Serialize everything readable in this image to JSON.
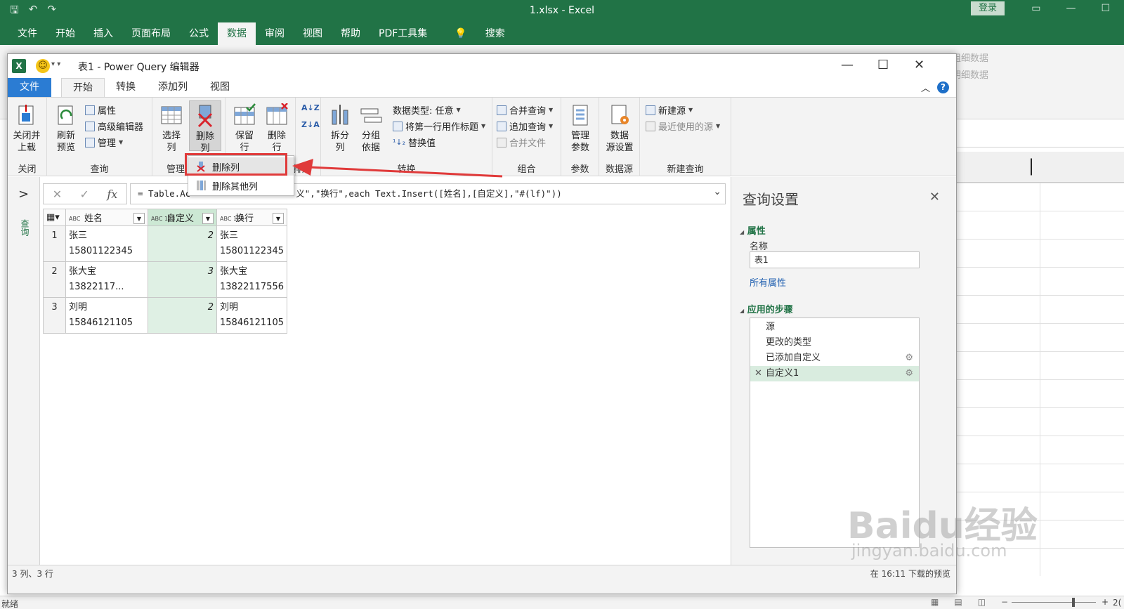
{
  "excel": {
    "title": "1.xlsx  -  Excel",
    "login": "登录",
    "menu": [
      "文件",
      "开始",
      "插入",
      "页面布局",
      "公式",
      "数据",
      "审阅",
      "视图",
      "帮助",
      "PDF工具集",
      "搜索"
    ],
    "active_menu": "数据",
    "ribbon_hint_1": "组细数据",
    "ribbon_hint_2": "明细数据",
    "status_ready": "就绪",
    "zoom": "2("
  },
  "pq": {
    "title": "表1 - Power Query 编辑器",
    "tabs": [
      "文件",
      "开始",
      "转换",
      "添加列",
      "视图"
    ],
    "ribbon": {
      "close": {
        "btn": "关闭并\n上载",
        "group": "关闭"
      },
      "query": {
        "refresh": "刷新\n预览",
        "props": "属性",
        "advanced": "高级编辑器",
        "manage": "管理",
        "group": "查询"
      },
      "manage_cols": {
        "select": "选择\n列",
        "remove": "删除\n列",
        "group": "管理"
      },
      "reduce_rows": {
        "keep": "保留\n行",
        "remove": "删除\n行",
        "group": "排序"
      },
      "transform": {
        "split": "拆分\n列",
        "groupby": "分组\n依据",
        "dtype": "数据类型: 任意",
        "firstrow": "将第一行用作标题",
        "replace": "替换值",
        "group": "转换"
      },
      "combine": {
        "merge": "合并查询",
        "append": "追加查询",
        "files": "合并文件",
        "group": "组合"
      },
      "params": {
        "btn": "管理\n参数",
        "group": "参数"
      },
      "datasource": {
        "btn": "数据\n源设置",
        "group": "数据源"
      },
      "newquery": {
        "new": "新建源",
        "recent": "最近使用的源",
        "group": "新建查询"
      }
    },
    "dropdown": [
      "删除列",
      "删除其他列"
    ],
    "left_label": "查询",
    "formula": "= Table.AddColumn(更改的类型, \"自定义\",\"换行\",each Text.Insert([姓名],[自定义],\"#(lf)\"))",
    "formula_visible": "= Table.Ac",
    "formula_tail": "义\",\"换行\",each Text.Insert([姓名],[自定义],\"#(lf)\"))",
    "columns": [
      {
        "type": "ABC",
        "name": "姓名"
      },
      {
        "type": "ABC 123",
        "name": "自定义"
      },
      {
        "type": "ABC 123",
        "name": "换行"
      }
    ],
    "rows": [
      {
        "n": "1",
        "name": "张三15801122345",
        "custom": "2",
        "break1": "张三",
        "break2": "15801122345"
      },
      {
        "n": "2",
        "name": "张大宝13822117...",
        "custom": "3",
        "break1": "张大宝",
        "break2": "13822117556"
      },
      {
        "n": "3",
        "name": "刘明15846121105",
        "custom": "2",
        "break1": "刘明",
        "break2": "15846121105"
      }
    ],
    "settings": {
      "title": "查询设置",
      "props_section": "属性",
      "name_label": "名称",
      "name_value": "表1",
      "all_props": "所有属性",
      "steps_section": "应用的步骤",
      "steps": [
        "源",
        "更改的类型",
        "已添加自定义",
        "自定义1"
      ]
    },
    "status_left": "3 列、3 行",
    "status_right": "在 16:11 下载的预览"
  },
  "watermark": {
    "brand": "Baidu经验",
    "url": "jingyan.baidu.com"
  }
}
